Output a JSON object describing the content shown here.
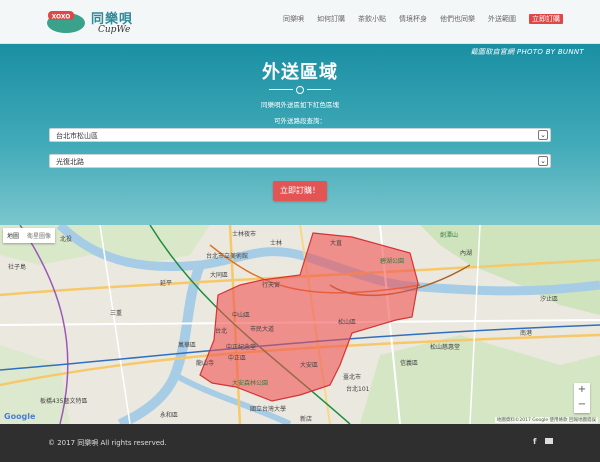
{
  "brand": {
    "name_zh": "同樂唄",
    "name_en": "CupWe",
    "cup_text": "XOXO"
  },
  "nav": {
    "items": [
      "同樂唄",
      "如何訂購",
      "茶飲小點",
      "情境杯身",
      "他們也同樂",
      "外送範圍"
    ],
    "cta": "立即訂購",
    "accent": "#e04848"
  },
  "hero": {
    "credit": "截圖取自官網 PHOTO BY BUNNT",
    "title": "外送區域",
    "subtitle": "同樂唄外送區如下紅色區塊",
    "query_label": "可外送路段查詢：",
    "district_select": "台北市松山區",
    "road_select": "光復北路",
    "order_button": "立即訂購！",
    "bg_color": "#2898a8",
    "button_color": "#e35555"
  },
  "map": {
    "tabs": [
      "地圖",
      "衛星圖像"
    ],
    "zoom_in": "+",
    "zoom_out": "−",
    "logo": "Google",
    "footer": "地圖資料©2017 Google  使用條款  回報地圖錯誤",
    "delivery_color": "#f05050",
    "labels": [
      "士林夜市",
      "劍潭山",
      "碧湖公園",
      "大直",
      "北投",
      "社子島",
      "延平",
      "大同區",
      "台北市立美術館",
      "行天宮",
      "中山區",
      "松山區",
      "信義區",
      "大安區",
      "大安森林公園",
      "中正區",
      "國立台灣大學",
      "台北101",
      "萬華區",
      "板橋435藝文特區",
      "永和區",
      "新店",
      "松山慈惠堂",
      "南港",
      "汐止區",
      "三重",
      "台北",
      "士林",
      "內湖",
      "市民大道",
      "中正紀念堂",
      "龍山寺",
      "臺北市"
    ]
  },
  "footer": {
    "copyright": "© 2017 同樂唄 All rights reserved.",
    "facebook_icon": "f",
    "mail_icon": "mail"
  }
}
